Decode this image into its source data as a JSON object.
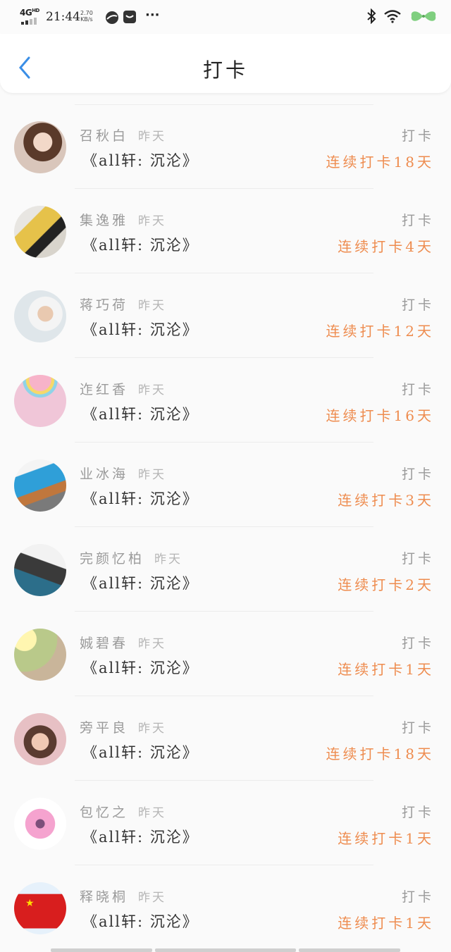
{
  "status": {
    "network": "4G",
    "network_hd": "HD",
    "time": "21:44",
    "speed_value": "2.70",
    "speed_unit": "KB/s",
    "more": "···"
  },
  "header": {
    "title": "打卡"
  },
  "items": [
    {
      "name": "召秋白",
      "when": "昨天",
      "book": "《all轩: 沉沦》",
      "action": "打卡",
      "streak": "连续打卡18天"
    },
    {
      "name": "集逸雅",
      "when": "昨天",
      "book": "《all轩: 沉沦》",
      "action": "打卡",
      "streak": "连续打卡4天"
    },
    {
      "name": "蒋巧荷",
      "when": "昨天",
      "book": "《all轩: 沉沦》",
      "action": "打卡",
      "streak": "连续打卡12天"
    },
    {
      "name": "迮红香",
      "when": "昨天",
      "book": "《all轩: 沉沦》",
      "action": "打卡",
      "streak": "连续打卡16天"
    },
    {
      "name": "业冰海",
      "when": "昨天",
      "book": "《all轩: 沉沦》",
      "action": "打卡",
      "streak": "连续打卡3天"
    },
    {
      "name": "完颜忆柏",
      "when": "昨天",
      "book": "《all轩: 沉沦》",
      "action": "打卡",
      "streak": "连续打卡2天"
    },
    {
      "name": "娍碧春",
      "when": "昨天",
      "book": "《all轩: 沉沦》",
      "action": "打卡",
      "streak": "连续打卡1天"
    },
    {
      "name": "旁平良",
      "when": "昨天",
      "book": "《all轩: 沉沦》",
      "action": "打卡",
      "streak": "连续打卡18天"
    },
    {
      "name": "包忆之",
      "when": "昨天",
      "book": "《all轩: 沉沦》",
      "action": "打卡",
      "streak": "连续打卡1天"
    },
    {
      "name": "释晓桐",
      "when": "昨天",
      "book": "《all轩: 沉沦》",
      "action": "打卡",
      "streak": "连续打卡1天"
    }
  ],
  "colors": {
    "accent": "#ee8c4f",
    "back": "#3a8ee6"
  }
}
